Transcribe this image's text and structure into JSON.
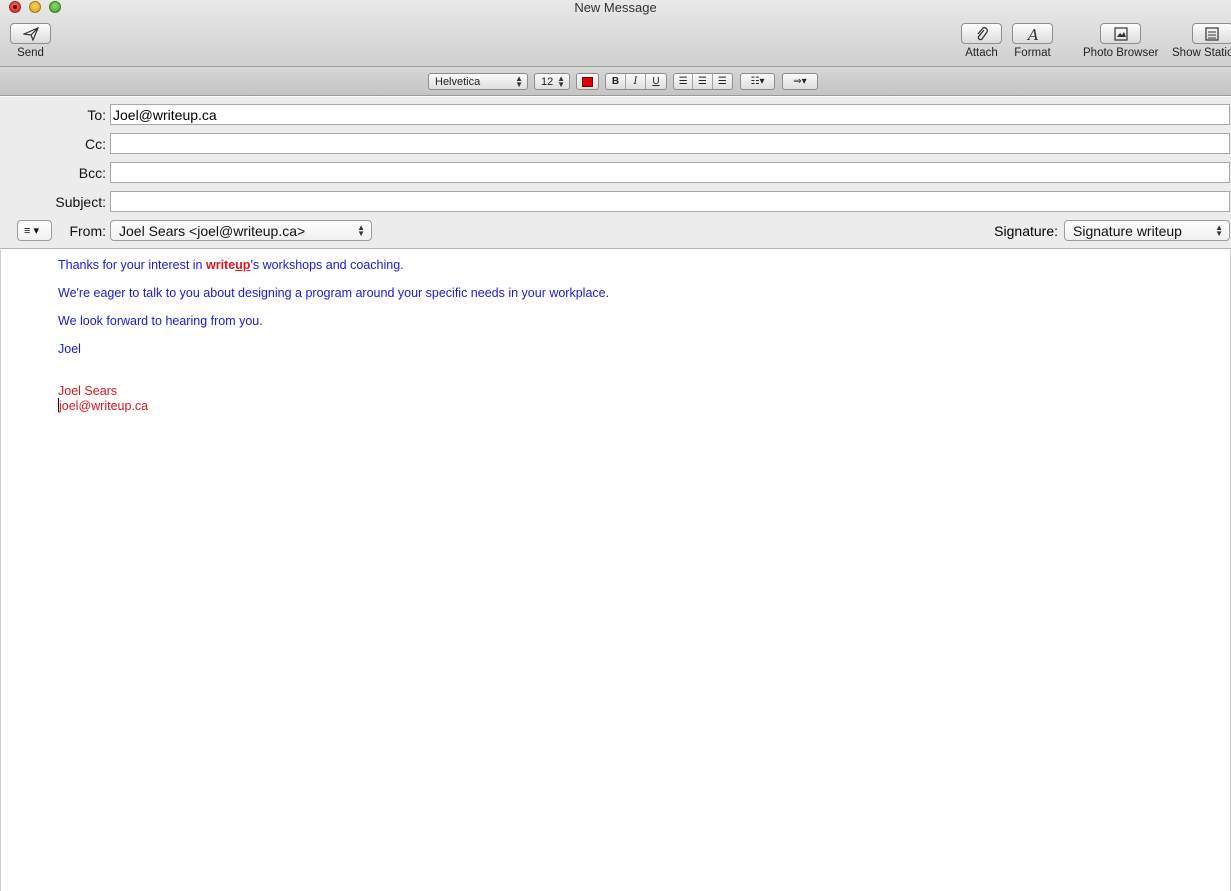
{
  "window": {
    "title": "New Message"
  },
  "toolbar": {
    "send_label": "Send",
    "attach_label": "Attach",
    "format_label": "Format",
    "photo_browser_label": "Photo Browser",
    "show_stationery_label": "Show Stationery"
  },
  "formatbar": {
    "font": "Helvetica",
    "size": "12",
    "text_color": "#e00000",
    "bold": "B",
    "italic": "I",
    "underline": "U"
  },
  "header": {
    "to_label": "To:",
    "to_value": "Joel@writeup.ca",
    "cc_label": "Cc:",
    "cc_value": "",
    "bcc_label": "Bcc:",
    "bcc_value": "",
    "subject_label": "Subject:",
    "subject_value": "",
    "from_label": "From:",
    "from_value": "Joel Sears <joel@writeup.ca>",
    "signature_label": "Signature:",
    "signature_value": "Signature writeup"
  },
  "body": {
    "line1_pre": "Thanks for your interest in ",
    "line1_brand_a": "write",
    "line1_brand_b": "up",
    "line1_post": "'s workshops and coaching.",
    "line2": "We're eager to talk to you about designing a program around your specific needs in your workplace.",
    "line3": "We look forward to hearing from you.",
    "line4": "Joel",
    "sig_name": "Joel Sears",
    "sig_email": "joel@writeup.ca"
  },
  "colors": {
    "body_text": "#1a1ad6",
    "brand": "#e0141e"
  }
}
